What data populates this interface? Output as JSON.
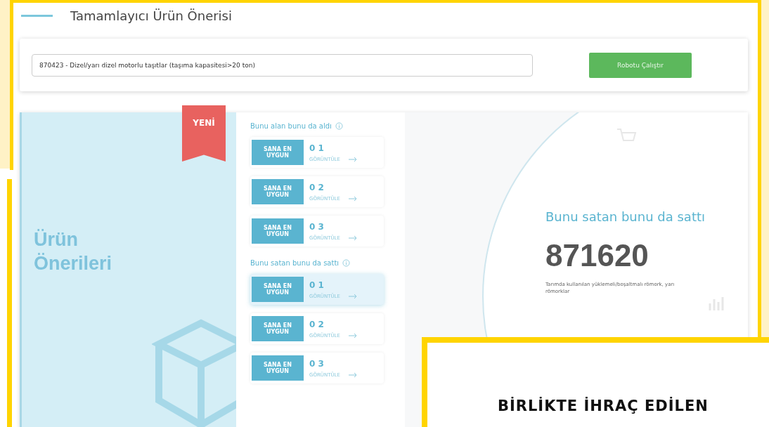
{
  "header": {
    "title": "Tamamlayıcı Ürün Önerisi"
  },
  "search": {
    "value": "870423 - Dizel/yarı dizel motorlu taşıtlar (taşıma kapasitesi>20 ton)",
    "button": "Robotu Çalıştır"
  },
  "intro": {
    "title": "Ürün Önerileri",
    "badge": "YENİ"
  },
  "sections": [
    {
      "title": "Bunu alan bunu da aldı",
      "items": [
        {
          "tag": "SANA EN UYGUN",
          "number": "0 1",
          "action": "GÖRÜNTÜLE",
          "selected": false
        },
        {
          "tag": "SANA EN UYGUN",
          "number": "0 2",
          "action": "GÖRÜNTÜLE",
          "selected": false
        },
        {
          "tag": "SANA EN UYGUN",
          "number": "0 3",
          "action": "GÖRÜNTÜLE",
          "selected": false
        }
      ]
    },
    {
      "title": "Bunu satan bunu da sattı",
      "items": [
        {
          "tag": "SANA EN UYGUN",
          "number": "0 1",
          "action": "GÖRÜNTÜLE",
          "selected": true
        },
        {
          "tag": "SANA EN UYGUN",
          "number": "0 2",
          "action": "GÖRÜNTÜLE",
          "selected": false
        },
        {
          "tag": "SANA EN UYGUN",
          "number": "0 3",
          "action": "GÖRÜNTÜLE",
          "selected": false
        }
      ]
    }
  ],
  "detail": {
    "title": "Bunu satan bunu da sattı",
    "code": "871620",
    "description": "Tarımda kullanılan yüklemeli/boşaltmalı römork, yarı römorklar"
  },
  "overlay": {
    "heading": "BİRLİKTE İHRAÇ EDİLEN"
  }
}
